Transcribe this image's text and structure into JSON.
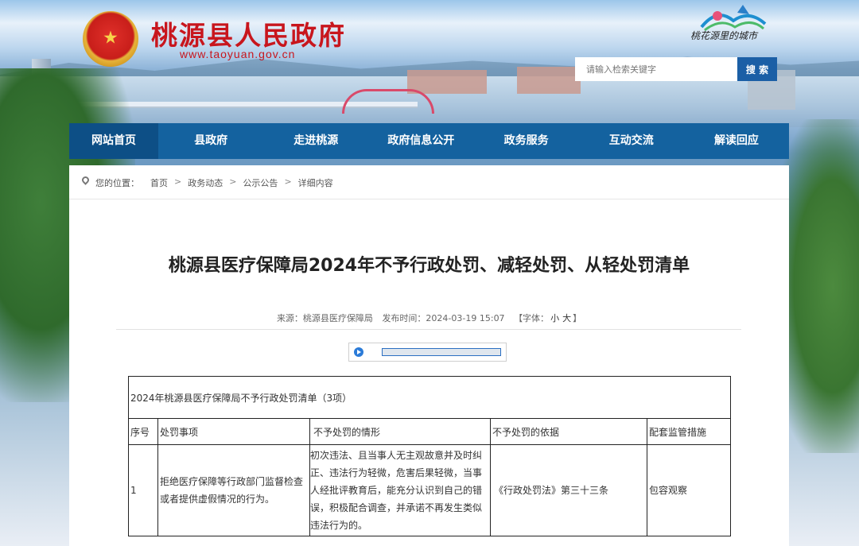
{
  "header": {
    "title": "桃源县人民政府",
    "url": "www.taoyuan.gov.cn",
    "slogan": "桃花源里的城市",
    "search": {
      "placeholder": "请输入检索关键字",
      "button": "搜 索"
    }
  },
  "nav": {
    "items": [
      "网站首页",
      "县政府",
      "走进桃源",
      "政府信息公开",
      "政务服务",
      "互动交流",
      "解读回应"
    ]
  },
  "breadcrumb": {
    "lead": "您的位置：",
    "items": [
      "首页",
      "政务动态",
      "公示公告",
      "详细内容"
    ],
    "separator": ">"
  },
  "article": {
    "title": "桃源县医疗保障局2024年不予行政处罚、减轻处罚、从轻处罚清单",
    "meta": {
      "source": "来源：桃源县医疗保障局",
      "time": "发布时间：2024-03-19 15:07",
      "font_open": "【字体：",
      "font_small": "小",
      "font_big": "大",
      "font_close": "】"
    }
  },
  "table": {
    "caption": "2024年桃源县医疗保障局不予行政处罚清单（3项）",
    "headers": [
      "序号",
      "处罚事项",
      "不予处罚的情形",
      "不予处罚的依据",
      "配套监管措施"
    ],
    "rows": [
      {
        "no": "1",
        "item": "拒绝医疗保障等行政部门监督检查或者提供虚假情况的行为。",
        "situation": "初次违法、且当事人无主观故意并及时纠正、违法行为轻微，危害后果轻微，当事人经批评教育后，能充分认识到自己的错误，积极配合调查，并承诺不再发生类似违法行为的。",
        "basis": "《行政处罚法》第三十三条",
        "measure": "包容观察"
      }
    ]
  },
  "colors": {
    "nav": "#14629f",
    "nav_active": "#0d4f86",
    "title_red": "#c8161d",
    "search_button": "#1b5fa6"
  }
}
